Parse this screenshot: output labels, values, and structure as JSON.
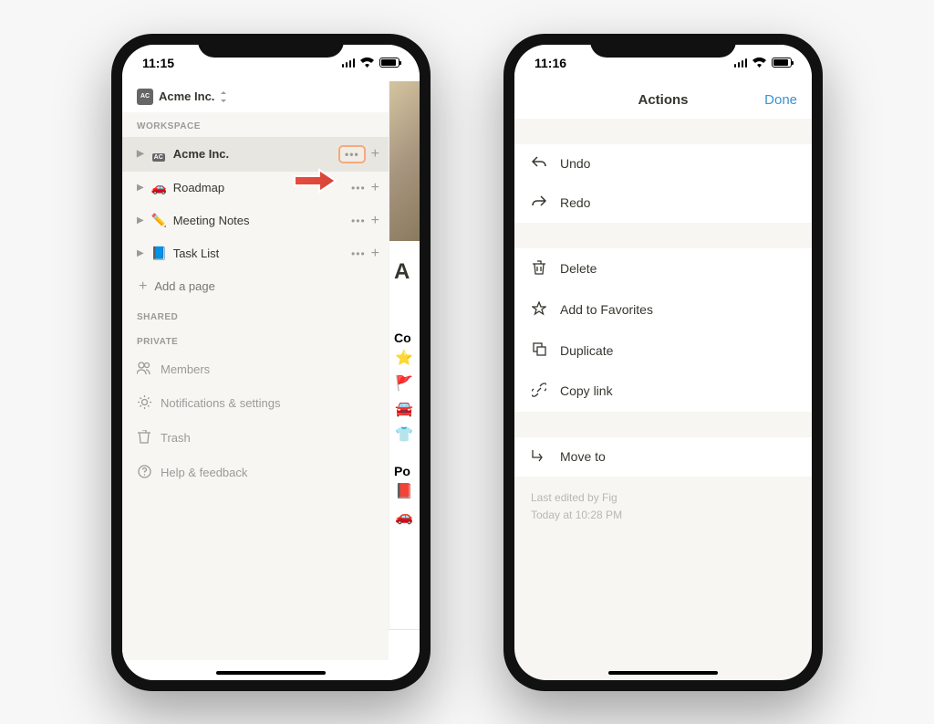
{
  "phone1": {
    "time": "11:15",
    "workspace": {
      "name": "Acme Inc.",
      "section_label": "WORKSPACE",
      "items": [
        {
          "label": "Acme Inc.",
          "icon": "🏷️",
          "selected": true,
          "has_actions": true,
          "highlighted_dots": true
        },
        {
          "label": "Roadmap",
          "icon": "🚗",
          "selected": false,
          "has_actions": true
        },
        {
          "label": "Meeting Notes",
          "icon": "✏️",
          "selected": false,
          "has_actions": true
        },
        {
          "label": "Task List",
          "icon": "📘",
          "selected": false,
          "has_actions": true
        }
      ],
      "add_page_label": "Add a page",
      "shared_label": "SHARED",
      "private_label": "PRIVATE"
    },
    "settings": [
      {
        "label": "Members",
        "icon": "members"
      },
      {
        "label": "Notifications & settings",
        "icon": "gear"
      },
      {
        "label": "Trash",
        "icon": "trash"
      },
      {
        "label": "Help & feedback",
        "icon": "help"
      }
    ],
    "content_peek": {
      "heading": "A",
      "subheading1": "Co",
      "subheading2": "Po"
    }
  },
  "phone2": {
    "time": "11:16",
    "header": {
      "title": "Actions",
      "done": "Done"
    },
    "actions": {
      "group1": [
        {
          "label": "Undo",
          "icon": "undo"
        },
        {
          "label": "Redo",
          "icon": "redo"
        }
      ],
      "group2": [
        {
          "label": "Delete",
          "icon": "trash"
        },
        {
          "label": "Add to Favorites",
          "icon": "star"
        },
        {
          "label": "Duplicate",
          "icon": "duplicate"
        },
        {
          "label": "Copy link",
          "icon": "link"
        }
      ],
      "group3": [
        {
          "label": "Move to",
          "icon": "moveto"
        }
      ]
    },
    "footer": {
      "line1": "Last edited by Fig",
      "line2": "Today at 10:28 PM"
    }
  }
}
